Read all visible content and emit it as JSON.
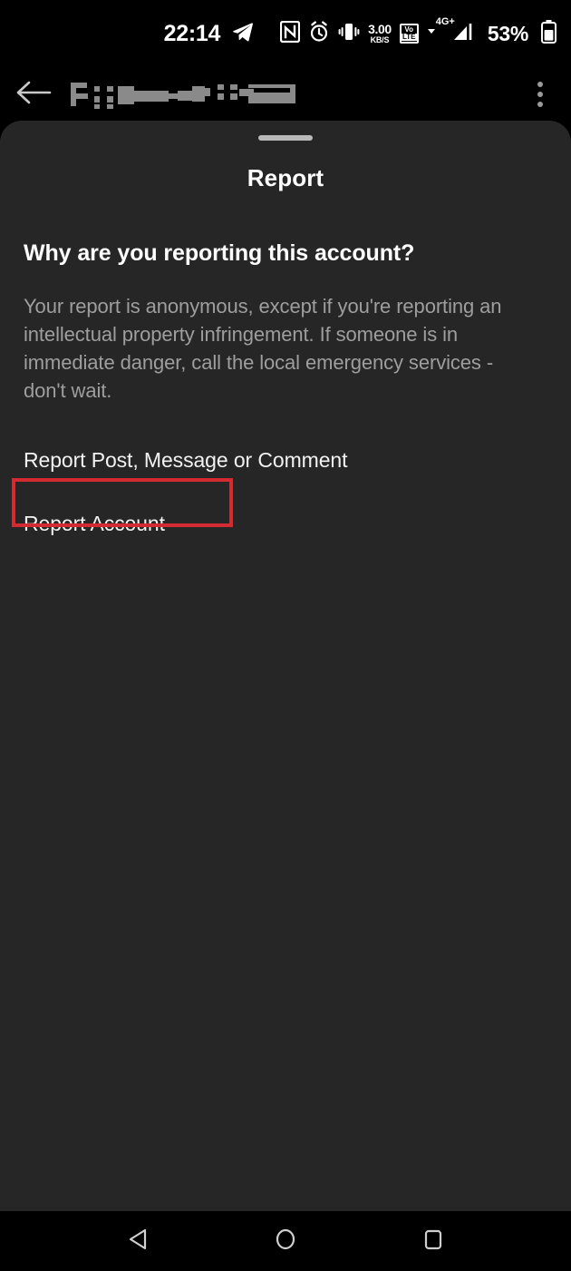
{
  "status_bar": {
    "time": "22:14",
    "send_icon": "telegram-send-icon",
    "nfc_icon": "nfc-icon",
    "alarm_icon": "alarm-clock-icon",
    "vibrate_icon": "vibrate-icon",
    "data_rate_value": "3.00",
    "data_rate_unit": "KB/S",
    "volte_top": "VoLTE",
    "volte_line1": "Vo",
    "volte_line2": "LTE",
    "network_type": "4G+",
    "signal_icon": "signal-bars-icon",
    "battery_percent": "53%",
    "battery_icon": "battery-icon"
  },
  "app_bar": {
    "back_icon": "back-arrow-icon",
    "title_redacted": true,
    "title": "",
    "overflow_icon": "overflow-menu-icon"
  },
  "sheet": {
    "drag_handle": "drag-handle",
    "title": "Report",
    "heading": "Why are you reporting this account?",
    "description": "Your report is anonymous, except if you're reporting an intellectual property infringement. If someone is in immediate danger, call the local emergency services - don't wait.",
    "options": [
      {
        "label": "Report Post, Message or Comment",
        "highlighted": false
      },
      {
        "label": "Report Account",
        "highlighted": true
      }
    ]
  },
  "annotation": {
    "color": "#d42b32",
    "target": "Report Account"
  },
  "nav_bar": {
    "back_icon": "nav-back-triangle-icon",
    "home_icon": "nav-home-circle-icon",
    "recents_icon": "nav-recents-square-icon"
  },
  "colors": {
    "screen_background": "#000000",
    "sheet_background": "#262626",
    "primary_text": "#ffffff",
    "secondary_text": "#9e9e9e",
    "annotation_red": "#d42b32"
  }
}
